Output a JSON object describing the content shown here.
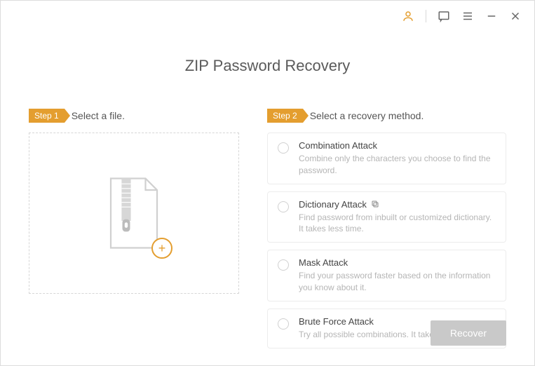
{
  "title": "ZIP Password Recovery",
  "step1": {
    "tag": "Step 1",
    "label": "Select a file."
  },
  "step2": {
    "tag": "Step 2",
    "label": "Select a recovery method."
  },
  "methods": [
    {
      "title": "Combination Attack",
      "desc": "Combine only the characters you choose to find the password."
    },
    {
      "title": "Dictionary Attack",
      "desc": "Find password from inbuilt or customized dictionary. It takes less time."
    },
    {
      "title": "Mask Attack",
      "desc": "Find your password faster based on the information you know about it."
    },
    {
      "title": "Brute Force Attack",
      "desc": "Try all possible combinations. It takes longer time."
    }
  ],
  "recover_label": "Recover",
  "colors": {
    "accent": "#e49e2f"
  }
}
